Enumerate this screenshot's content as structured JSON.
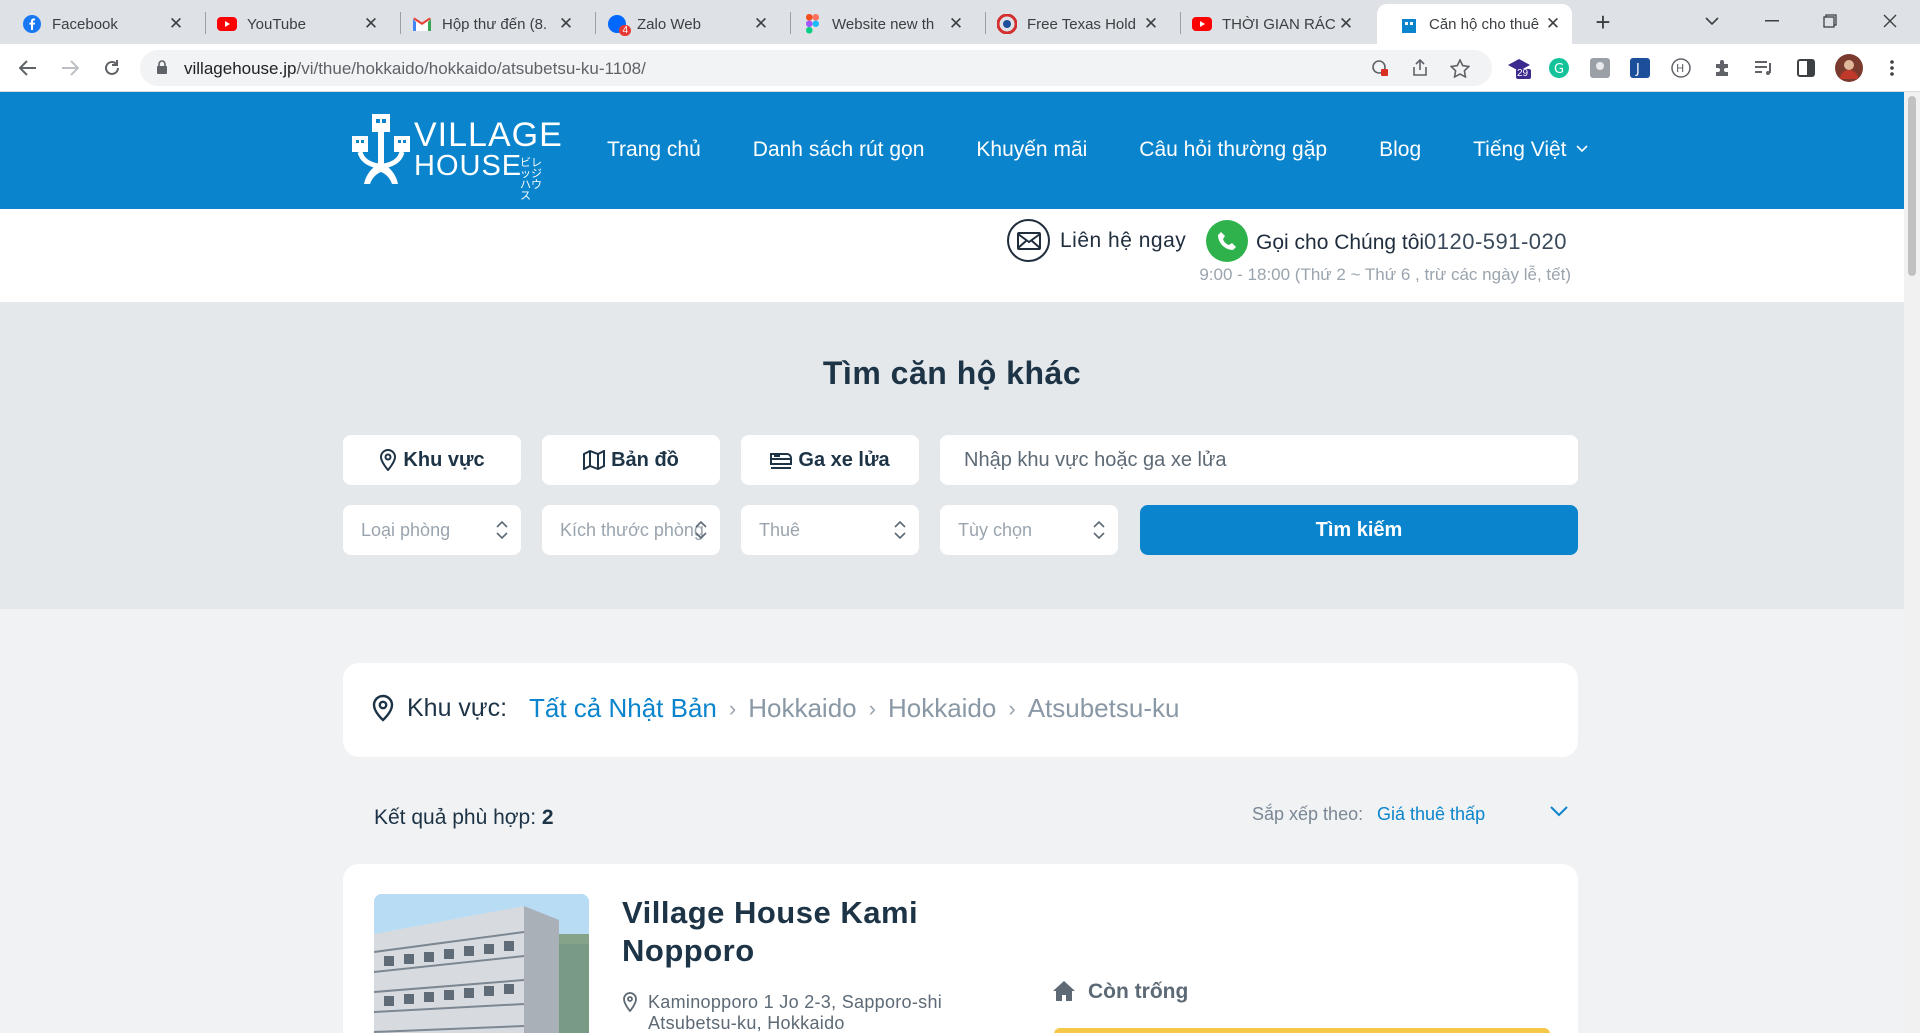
{
  "browser": {
    "tabs": [
      {
        "title": "Facebook",
        "icon": "facebook-icon"
      },
      {
        "title": "YouTube",
        "icon": "youtube-icon"
      },
      {
        "title": "Hộp thư đến (8.",
        "icon": "gmail-icon"
      },
      {
        "title": "Zalo Web",
        "icon": "zalo-icon",
        "badge": "4"
      },
      {
        "title": "Website new th",
        "icon": "figma-icon"
      },
      {
        "title": "Free Texas Hold",
        "icon": "poker-icon"
      },
      {
        "title": "THỜI GIAN RÁC",
        "icon": "youtube-icon"
      },
      {
        "title": "Căn hộ cho thuê",
        "icon": "villagehouse-icon"
      }
    ],
    "url_host": "villagehouse.jp",
    "url_path": "/vi/thue/hokkaido/hokkaido/atsubetsu-ku-1108/",
    "ext_badge": "29"
  },
  "header": {
    "logo_line1": "VILLAGE",
    "logo_line2": "HOUSE",
    "logo_kana": "ビレッジ ハウス",
    "nav": [
      "Trang chủ",
      "Danh sách rút gọn",
      "Khuyến mãi",
      "Câu hỏi thường gặp",
      "Blog",
      "Tiếng Việt"
    ]
  },
  "contact": {
    "contact_link": "Liên hệ ngay",
    "call_label": "Gọi cho Chúng tôi",
    "phone": "0120-591-020",
    "hours": "9:00 - 18:00 (Thứ 2 ~ Thứ 6 , trừ các ngày lễ, tết)"
  },
  "search": {
    "title": "Tìm căn hộ khác",
    "btn_area": "Khu vực",
    "btn_map": "Bản đồ",
    "btn_station": "Ga xe lửa",
    "placeholder": "Nhập khu vực hoặc ga xe lửa",
    "sel_room_type": "Loại phòng",
    "sel_room_size": "Kích thước phòng",
    "sel_rent": "Thuê",
    "sel_options": "Tùy chọn",
    "submit": "Tìm kiếm"
  },
  "breadcrumb": {
    "label": "Khu vực:",
    "items": [
      "Tất cả Nhật Bản",
      "Hokkaido",
      "Hokkaido",
      "Atsubetsu-ku"
    ]
  },
  "results": {
    "count_label": "Kết quả phù hợp:",
    "count": "2",
    "sort_label": "Sắp xếp theo:",
    "sort_value": "Giá thuê thấp"
  },
  "listing": {
    "name": "Village House Kami Nopporo",
    "address": "Kaminopporo 1 Jo 2-3, Sapporo-shi Atsubetsu-ku, Hokkaido",
    "vacancy": "Còn trống"
  },
  "colors": {
    "brand_blue": "#0a84cc",
    "phone_green": "#2fb24c",
    "vacancy_yellow": "#f5c84a"
  }
}
